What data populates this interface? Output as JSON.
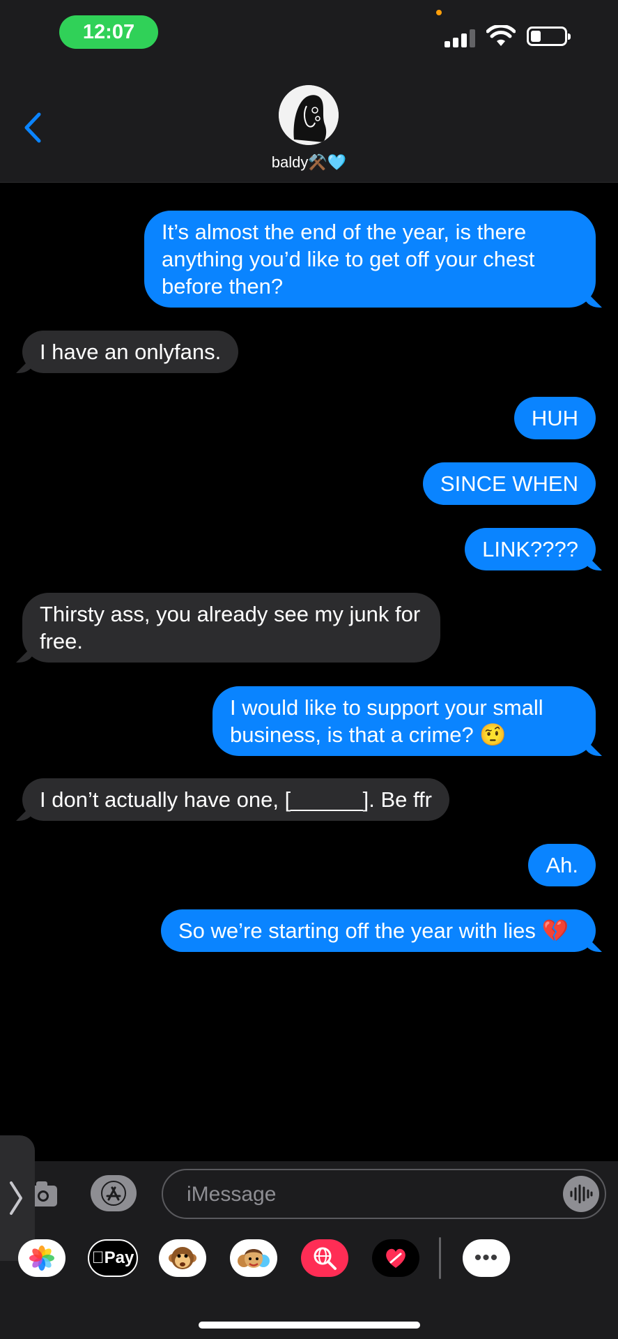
{
  "status_bar": {
    "time": "12:07"
  },
  "header": {
    "contact_name": "baldy⚒️🩵",
    "avatar_icon": "profile-photo"
  },
  "messages": [
    {
      "from": "me",
      "text": "It’s almost the end of the year, is there anything you’d like to get off your chest before then?"
    },
    {
      "from": "them",
      "text": "I have an onlyfans."
    },
    {
      "from": "me",
      "text": "HUH"
    },
    {
      "from": "me",
      "text": "SINCE WHEN"
    },
    {
      "from": "me",
      "text": "LINK????"
    },
    {
      "from": "them",
      "text": "Thirsty ass, you already see my junk for free."
    },
    {
      "from": "me",
      "text": "I would like to support your small business, is that a crime? 🤨"
    },
    {
      "from": "them",
      "text": "I don’t actually have one, [______]. Be ffr"
    },
    {
      "from": "me",
      "text": "Ah."
    },
    {
      "from": "me",
      "text": "So we’re starting off the year with lies 💔"
    }
  ],
  "input": {
    "placeholder": "iMessage"
  },
  "app_drawer": {
    "apple_pay_label": "Pay",
    "more_label": "•••"
  },
  "colors": {
    "outgoing_bubble": "#0a84ff",
    "incoming_bubble": "#2c2c2e",
    "background": "#000000",
    "time_pill": "#30d158"
  }
}
